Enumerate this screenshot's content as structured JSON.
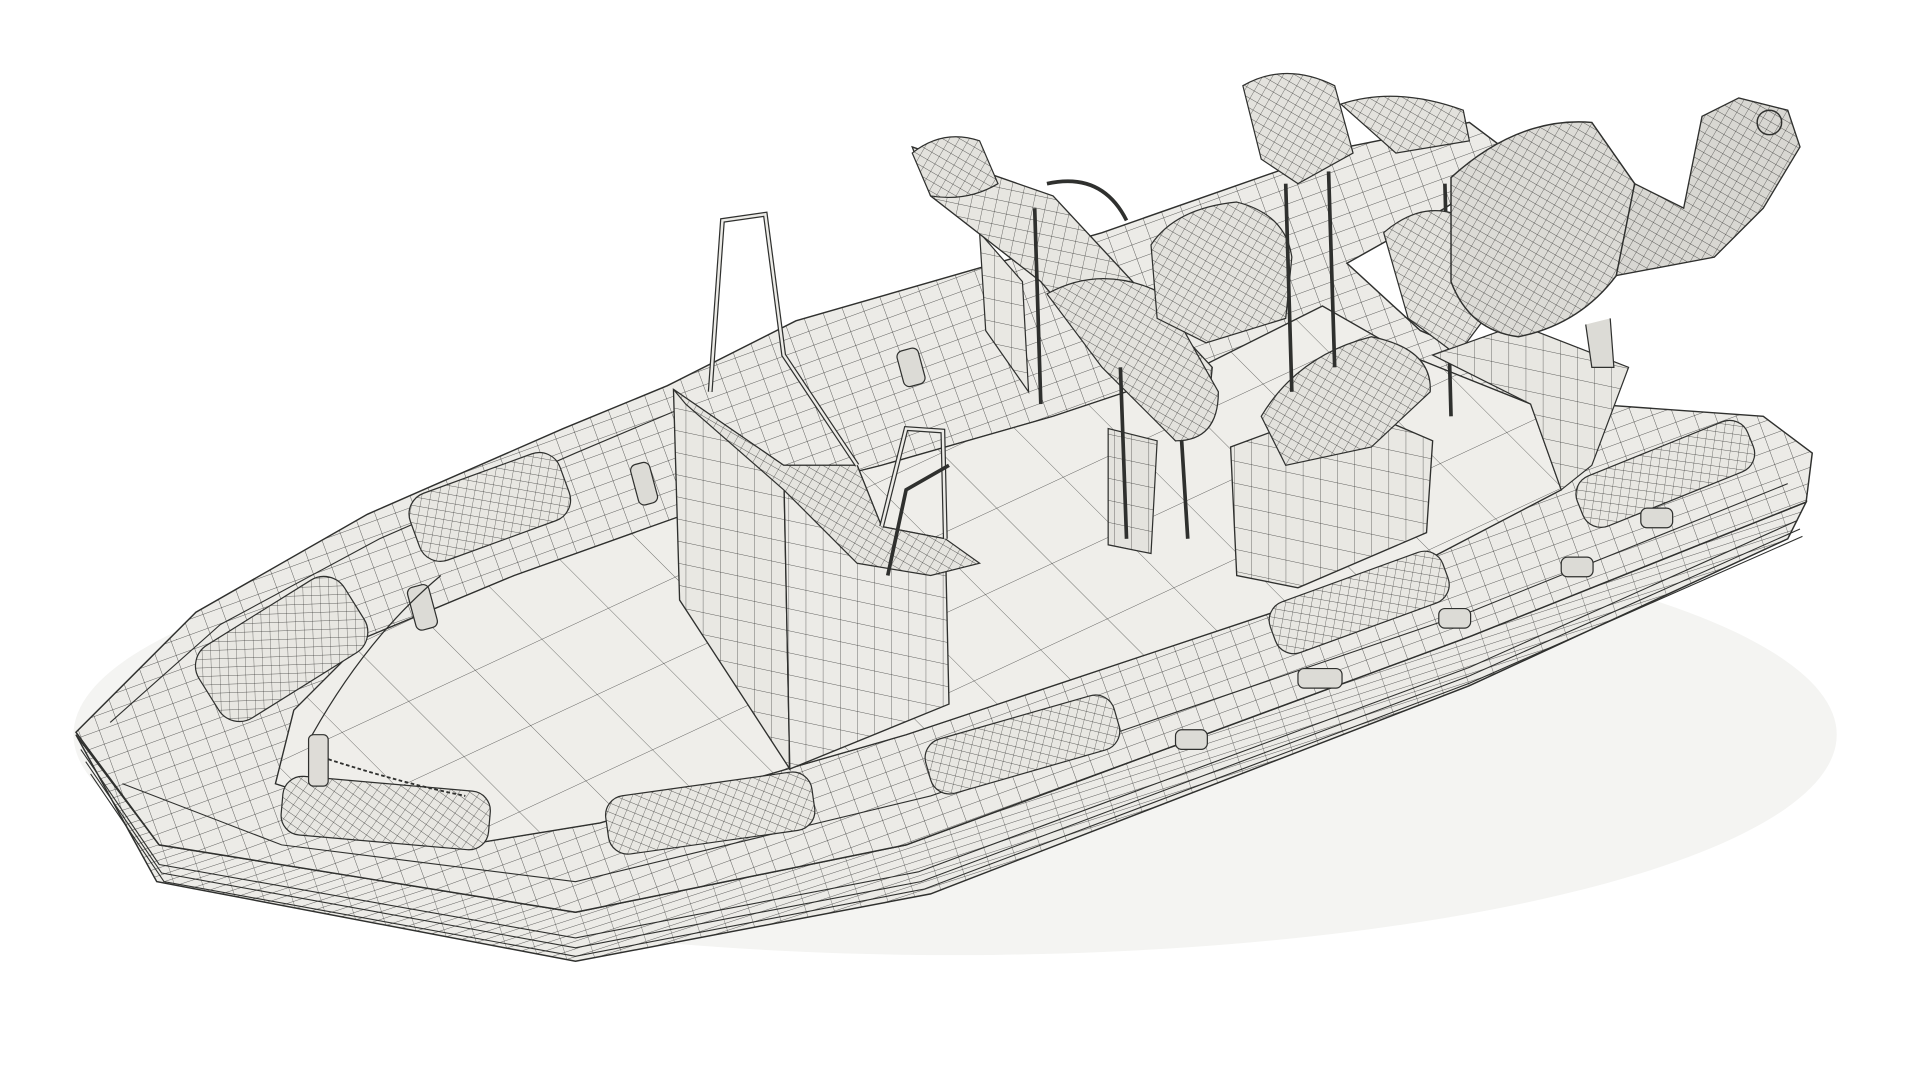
{
  "scene": {
    "background_color": "#ffffff",
    "surface_color": "#ecebe7",
    "wire_color": "#2f302e",
    "shadow_color": "#d9d8d3"
  }
}
